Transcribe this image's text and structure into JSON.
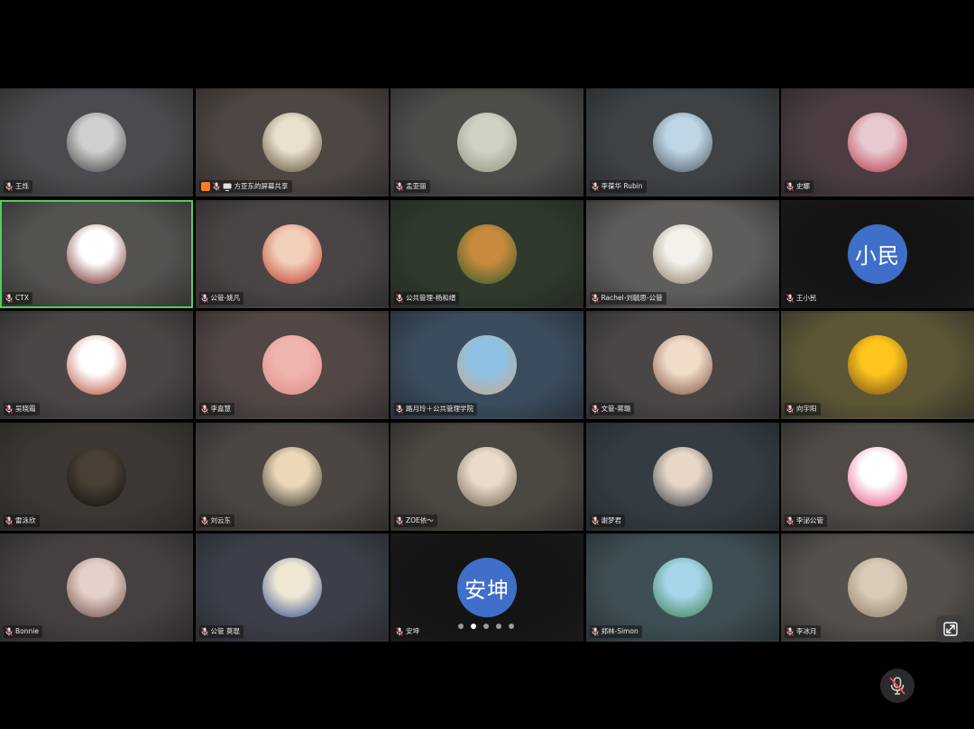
{
  "participants": [
    {
      "name": "王烁",
      "bg": "#4b4a4e",
      "avatar": {
        "kind": "photo",
        "colors": [
          "#cfcfcf",
          "#3a3a3a"
        ]
      }
    },
    {
      "name": "方亚东的屏幕共享",
      "bg": "#4d4642",
      "sharing": true,
      "avatar": {
        "kind": "photo",
        "colors": [
          "#e9e0cf",
          "#5a4a30"
        ]
      }
    },
    {
      "name": "孟亚丽",
      "bg": "#4c4d49",
      "avatar": {
        "kind": "photo",
        "colors": [
          "#cfd3c4",
          "#8d927a"
        ]
      }
    },
    {
      "name": "李葆华 Rubin",
      "bg": "#3e4245",
      "avatar": {
        "kind": "photo",
        "colors": [
          "#bfd6e6",
          "#49545c"
        ]
      }
    },
    {
      "name": "史娜",
      "bg": "#4a3c40",
      "avatar": {
        "kind": "photo",
        "colors": [
          "#e7c9d0",
          "#b33240"
        ]
      }
    },
    {
      "name": "CTX",
      "bg": "#54524f",
      "active": true,
      "avatar": {
        "kind": "photo",
        "colors": [
          "#ffffff",
          "#6b1c1c"
        ]
      }
    },
    {
      "name": "公管-姚凡",
      "bg": "#4a4545",
      "avatar": {
        "kind": "photo",
        "colors": [
          "#f2cfb8",
          "#c0342c"
        ]
      }
    },
    {
      "name": "公共管理-杨和缙",
      "bg": "#2f3a2d",
      "avatar": {
        "kind": "photo",
        "colors": [
          "#c98a3d",
          "#2c5a2a"
        ]
      }
    },
    {
      "name": "Rachel-刘毓思-公管",
      "bg": "#5e5d5b",
      "avatar": {
        "kind": "photo",
        "colors": [
          "#f3f1ea",
          "#8a7a66"
        ]
      }
    },
    {
      "name": "王小民",
      "bg": "#141414",
      "avatar": {
        "kind": "text",
        "text": "小民"
      }
    },
    {
      "name": "吴晓霜",
      "bg": "#4b4646",
      "avatar": {
        "kind": "photo",
        "colors": [
          "#ffffff",
          "#b6432f"
        ]
      }
    },
    {
      "name": "李嘉慧",
      "bg": "#524745",
      "avatar": {
        "kind": "photo",
        "colors": [
          "#f1b5b0",
          "#d98c86"
        ]
      }
    },
    {
      "name": "路月玲＋公共管理学院",
      "bg": "#3a4c5e",
      "avatar": {
        "kind": "photo",
        "colors": [
          "#8ec1e4",
          "#c8a98a"
        ]
      }
    },
    {
      "name": "文管-蒋璐",
      "bg": "#4a4646",
      "avatar": {
        "kind": "photo",
        "colors": [
          "#f0dcc8",
          "#7b4f3a"
        ]
      }
    },
    {
      "name": "向宇阳",
      "bg": "#5d5636",
      "avatar": {
        "kind": "photo",
        "colors": [
          "#ffc51c",
          "#6b4a1c"
        ]
      }
    },
    {
      "name": "雷泳欣",
      "bg": "#3c3732",
      "avatar": {
        "kind": "photo",
        "colors": [
          "#4a3f34",
          "#0e0e0e"
        ]
      }
    },
    {
      "name": "刘云东",
      "bg": "#4c4642",
      "avatar": {
        "kind": "photo",
        "colors": [
          "#ecd8b8",
          "#2a2a2a"
        ]
      }
    },
    {
      "name": "ZOE依～",
      "bg": "#4b4741",
      "avatar": {
        "kind": "photo",
        "colors": [
          "#e9dccb",
          "#6e6151"
        ]
      }
    },
    {
      "name": "谢梦君",
      "bg": "#343c42",
      "avatar": {
        "kind": "photo",
        "colors": [
          "#e8d6c6",
          "#2a3942"
        ]
      }
    },
    {
      "name": "李泌公管",
      "bg": "#4e4a45",
      "avatar": {
        "kind": "photo",
        "colors": [
          "#ffffff",
          "#e64b7c"
        ]
      }
    },
    {
      "name": "Bonnie",
      "bg": "#45403f",
      "avatar": {
        "kind": "photo",
        "colors": [
          "#e5d1c8",
          "#6b4a42"
        ]
      }
    },
    {
      "name": "公管 莫琨",
      "bg": "#3c3f4a",
      "avatar": {
        "kind": "photo",
        "colors": [
          "#f0e6d4",
          "#2e4a8a"
        ]
      }
    },
    {
      "name": "安坤",
      "bg": "#141414",
      "avatar": {
        "kind": "text",
        "text": "安坤"
      }
    },
    {
      "name": "郑林-Simon",
      "bg": "#3d4f55",
      "avatar": {
        "kind": "photo",
        "colors": [
          "#a6d6ea",
          "#3b7a4a"
        ]
      }
    },
    {
      "name": "李冰月",
      "bg": "#55504b",
      "avatar": {
        "kind": "photo",
        "colors": [
          "#d8ccb8",
          "#8a7a64"
        ]
      }
    }
  ],
  "pager": {
    "count": 5,
    "current": 2
  },
  "colors": {
    "active_border": "#4ecf5e",
    "text_avatar_bg": "#3f6fc8",
    "share_badge": "#ff7a1a"
  },
  "controls": {
    "fullscreen_icon": "exit-fullscreen-icon",
    "mute_icon": "mic-muted-icon"
  }
}
